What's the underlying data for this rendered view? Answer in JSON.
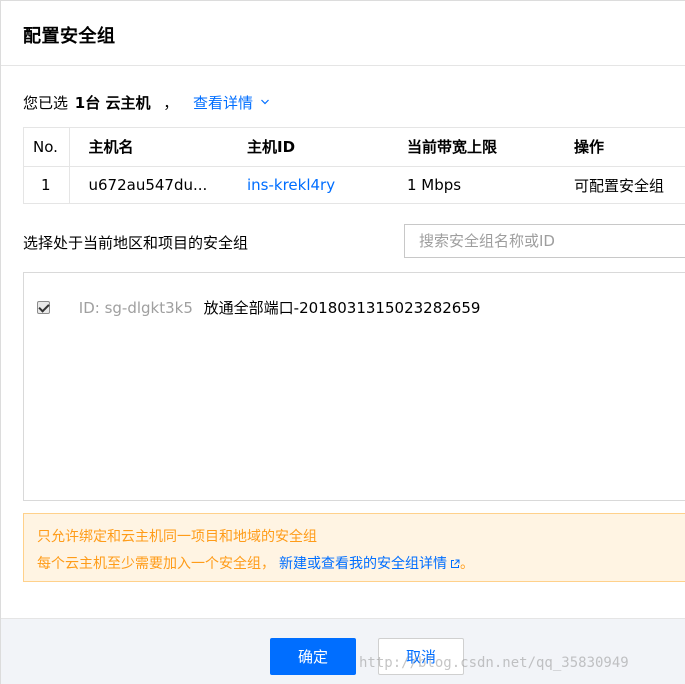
{
  "dialog": {
    "title": "配置安全组"
  },
  "selection": {
    "prefix": "您已选",
    "count": "1台 云主机",
    "comma": "，",
    "detail_link": "查看详情"
  },
  "table": {
    "headers": [
      "No.",
      "主机名",
      "主机ID",
      "当前带宽上限",
      "操作"
    ],
    "rows": [
      {
        "no": "1",
        "hostname": "u672au547du...",
        "host_id": "ins-krekl4ry",
        "bandwidth": "1 Mbps",
        "action": "可配置安全组"
      }
    ]
  },
  "picker": {
    "label": "选择处于当前地区和项目的安全组",
    "search_placeholder": "搜索安全组名称或ID",
    "search_value": ""
  },
  "security_groups": [
    {
      "checked": true,
      "id_text": "ID: sg-dlgkt3k5",
      "name": "放通全部端口-2018031315023282659"
    }
  ],
  "notice": {
    "line1": "只允许绑定和云主机同一项目和地域的安全组",
    "line2_prefix": "每个云主机至少需要加入一个安全组，",
    "line2_link": "新建或查看我的安全组详情",
    "line2_suffix": "。"
  },
  "footer": {
    "ok_label": "确定",
    "cancel_label": "取消"
  },
  "watermark": "http://blog.csdn.net/qq_35830949",
  "colors": {
    "accent": "#006eff",
    "notice_bg": "#fff4e3",
    "notice_text": "#ff9c19",
    "notice_border": "#ffd18b"
  },
  "icons": {
    "detail_chevron": "chevron-down-icon",
    "external_link": "external-link-icon",
    "checkbox": "checkbox-checked-icon"
  }
}
